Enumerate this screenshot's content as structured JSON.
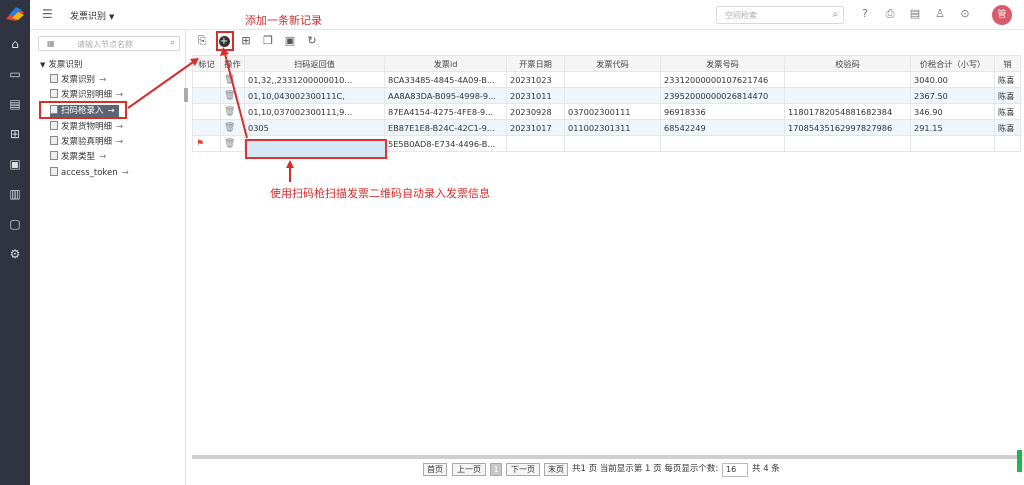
{
  "header": {
    "app_title": "发票识别",
    "search_placeholder": "空间检索",
    "avatar_text": "管"
  },
  "tree": {
    "search_placeholder": "请输入节点名称",
    "root_label": "发票识别",
    "items": [
      {
        "label": "发票识别"
      },
      {
        "label": "发票识别明细"
      },
      {
        "label": "扫码枪录入"
      },
      {
        "label": "发票货物明细"
      },
      {
        "label": "发票验真明细"
      },
      {
        "label": "发票类型"
      },
      {
        "label": "access_token"
      }
    ]
  },
  "table": {
    "columns": [
      "标记",
      "操作",
      "扫码返回值",
      "发票id",
      "开票日期",
      "发票代码",
      "发票号码",
      "校验码",
      "价税合计（小写）",
      "销"
    ],
    "rows": [
      [
        "",
        "",
        "01,32,,2331200000010...",
        "8CA33485-4845-4A09-B...",
        "20231023",
        "",
        "23312000000107621746",
        "",
        "3040.00",
        "陈喜"
      ],
      [
        "",
        "",
        "01,10,043002300111C,",
        "AA8A83DA-B095-4998-9...",
        "20231011",
        "",
        "23952000000026814470",
        "",
        "2367.50",
        "陈喜"
      ],
      [
        "",
        "",
        "01,10,037002300111,9...",
        "87EA4154-4275-4FE8-9...",
        "20230928",
        "037002300111",
        "96918336",
        "11801782054881682384",
        "346.90",
        "陈喜"
      ],
      [
        "",
        "",
        "0305",
        "EB87E1E8-B24C-42C1-9...",
        "20231017",
        "011002301311",
        "68542249",
        "17085435162997827986",
        "291.15",
        "陈喜"
      ],
      [
        "",
        "",
        "",
        "5E5B0AD8-E734-4496-B...",
        "",
        "",
        "",
        "",
        "",
        ""
      ]
    ]
  },
  "annotations": {
    "add_record": "添加一条新记录",
    "scan_hint": "使用扫码枪扫描发票二维码自动录入发票信息"
  },
  "pager": {
    "first": "首页",
    "prev": "上一页",
    "current": "1",
    "next": "下一页",
    "last": "末页",
    "summary": "共1 页 当前显示第 1 页 每页显示个数:",
    "page_size": "16",
    "total": "共 4 条"
  }
}
